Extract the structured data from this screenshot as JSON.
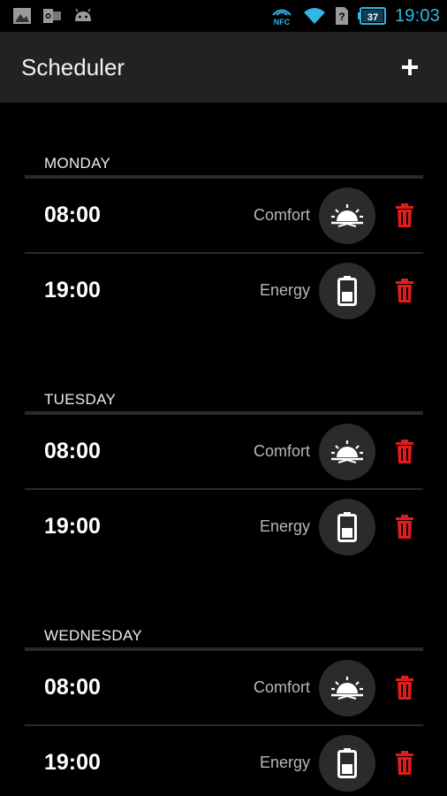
{
  "status_bar": {
    "time": "19:03",
    "battery": "37",
    "nfc_label": "NFC",
    "icons": [
      "image-icon",
      "outlook-icon",
      "android-icon",
      "nfc-icon",
      "wifi-icon",
      "sim-unknown-icon",
      "battery-icon"
    ],
    "accent_color": "#33b5e5"
  },
  "action_bar": {
    "title": "Scheduler",
    "add_label": "+"
  },
  "days": [
    {
      "name": "MONDAY",
      "entries": [
        {
          "time": "08:00",
          "mode": "Comfort",
          "icon": "sunrise-icon"
        },
        {
          "time": "19:00",
          "mode": "Energy",
          "icon": "battery-icon"
        }
      ]
    },
    {
      "name": "TUESDAY",
      "entries": [
        {
          "time": "08:00",
          "mode": "Comfort",
          "icon": "sunrise-icon"
        },
        {
          "time": "19:00",
          "mode": "Energy",
          "icon": "battery-icon"
        }
      ]
    },
    {
      "name": "WEDNESDAY",
      "entries": [
        {
          "time": "08:00",
          "mode": "Comfort",
          "icon": "sunrise-icon"
        },
        {
          "time": "19:00",
          "mode": "Energy",
          "icon": "battery-icon"
        }
      ]
    }
  ],
  "colors": {
    "delete": "#e21b1b",
    "background": "#000000",
    "action_bar": "#222222"
  }
}
